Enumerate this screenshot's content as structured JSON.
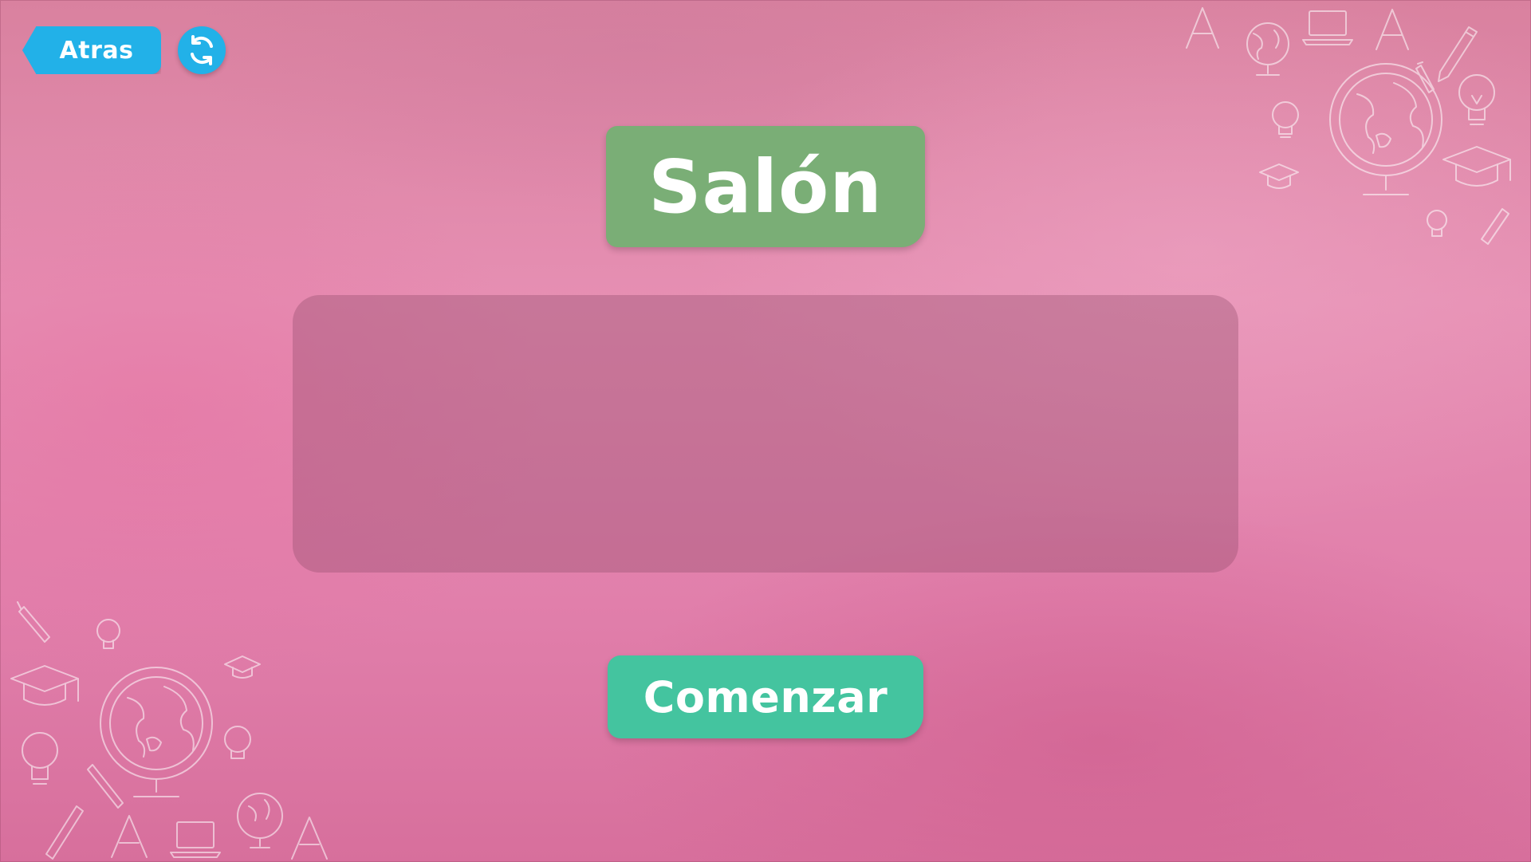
{
  "nav": {
    "back_label": "Atras",
    "refresh_icon": "refresh-icon"
  },
  "title": {
    "text": "Salón"
  },
  "start": {
    "label": "Comenzar"
  },
  "colors": {
    "background": "#e48bb1",
    "nav_button": "#22b1e8",
    "title_badge": "#7aae76",
    "start_button": "#44c49f",
    "panel": "#b06a8c"
  },
  "decorations": {
    "top_right": [
      "letter-a-icon",
      "globe-icon",
      "laptop-icon",
      "pencil-icon",
      "lightbulb-icon",
      "graduation-cap-icon"
    ],
    "bottom_left": [
      "pencil-icon",
      "lightbulb-icon",
      "graduation-cap-icon",
      "globe-icon",
      "letter-a-icon",
      "laptop-icon"
    ]
  }
}
